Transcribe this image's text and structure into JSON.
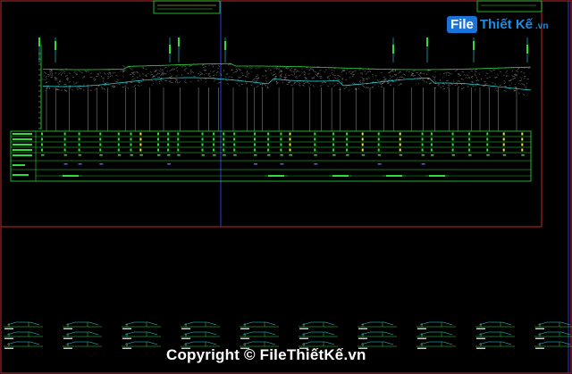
{
  "watermark": {
    "logo_box": "File",
    "logo_rest": "Thiết Kế",
    "logo_domain": ".vn",
    "copyright": "Copyright © FileThiếtKế.vn"
  },
  "colors": {
    "background": "#000000",
    "frame_red": "#c0282a",
    "divider_blue": "#2a3bd6",
    "green": "#2fdc3a",
    "yellow": "#e8e63a",
    "cyan": "#2ae0e6",
    "hatch": "#c9c9c9"
  },
  "icons": [
    "file-logo-icon"
  ]
}
